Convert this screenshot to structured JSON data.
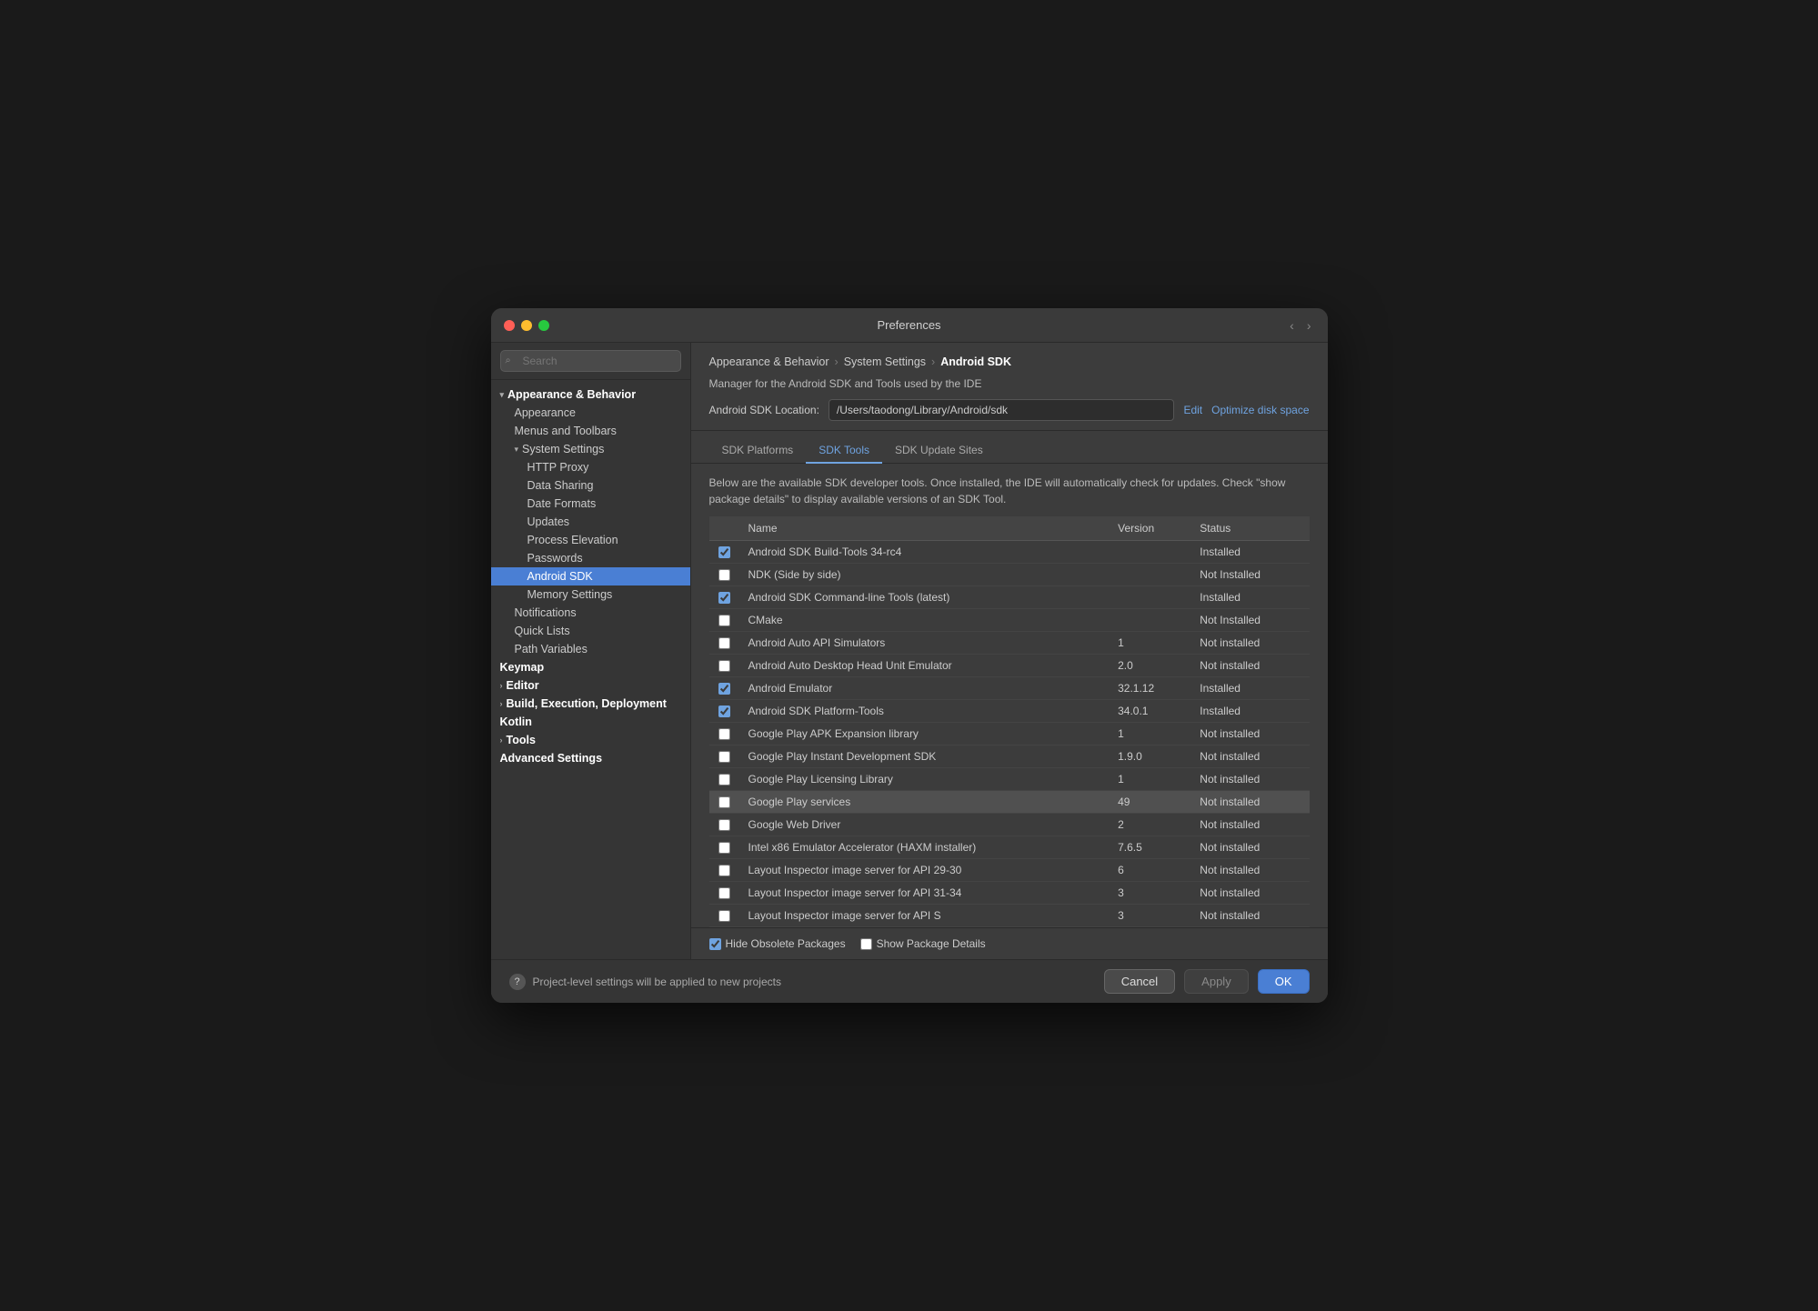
{
  "window": {
    "title": "Preferences"
  },
  "breadcrumb": {
    "part1": "Appearance & Behavior",
    "part2": "System Settings",
    "part3": "Android SDK"
  },
  "sidebar": {
    "search_placeholder": "Search",
    "items": [
      {
        "id": "appearance-behavior",
        "label": "Appearance & Behavior",
        "level": "group",
        "expanded": true,
        "chevron": "▾"
      },
      {
        "id": "appearance",
        "label": "Appearance",
        "level": "sub"
      },
      {
        "id": "menus-toolbars",
        "label": "Menus and Toolbars",
        "level": "sub"
      },
      {
        "id": "system-settings",
        "label": "System Settings",
        "level": "sub",
        "expanded": true,
        "chevron": "▾"
      },
      {
        "id": "http-proxy",
        "label": "HTTP Proxy",
        "level": "subsub"
      },
      {
        "id": "data-sharing",
        "label": "Data Sharing",
        "level": "subsub"
      },
      {
        "id": "date-formats",
        "label": "Date Formats",
        "level": "subsub"
      },
      {
        "id": "updates",
        "label": "Updates",
        "level": "subsub"
      },
      {
        "id": "process-elevation",
        "label": "Process Elevation",
        "level": "subsub"
      },
      {
        "id": "passwords",
        "label": "Passwords",
        "level": "subsub"
      },
      {
        "id": "android-sdk",
        "label": "Android SDK",
        "level": "subsub",
        "active": true
      },
      {
        "id": "memory-settings",
        "label": "Memory Settings",
        "level": "subsub"
      },
      {
        "id": "notifications",
        "label": "Notifications",
        "level": "sub"
      },
      {
        "id": "quick-lists",
        "label": "Quick Lists",
        "level": "sub"
      },
      {
        "id": "path-variables",
        "label": "Path Variables",
        "level": "sub"
      },
      {
        "id": "keymap",
        "label": "Keymap",
        "level": "group"
      },
      {
        "id": "editor",
        "label": "Editor",
        "level": "group",
        "chevron": "›"
      },
      {
        "id": "build-execution",
        "label": "Build, Execution, Deployment",
        "level": "group",
        "chevron": "›"
      },
      {
        "id": "kotlin",
        "label": "Kotlin",
        "level": "group"
      },
      {
        "id": "tools",
        "label": "Tools",
        "level": "group",
        "chevron": "›"
      },
      {
        "id": "advanced-settings",
        "label": "Advanced Settings",
        "level": "group"
      }
    ]
  },
  "panel": {
    "description": "Manager for the Android SDK and Tools used by the IDE",
    "sdk_location_label": "Android SDK Location:",
    "sdk_location_value": "/Users/taodong/Library/Android/sdk",
    "edit_label": "Edit",
    "optimize_label": "Optimize disk space"
  },
  "tabs": [
    {
      "id": "sdk-platforms",
      "label": "SDK Platforms"
    },
    {
      "id": "sdk-tools",
      "label": "SDK Tools",
      "active": true
    },
    {
      "id": "sdk-update-sites",
      "label": "SDK Update Sites"
    }
  ],
  "table": {
    "description": "Below are the available SDK developer tools. Once installed, the IDE will automatically check for updates. Check \"show package details\" to display available versions of an SDK Tool.",
    "columns": [
      "",
      "Name",
      "Version",
      "Status"
    ],
    "rows": [
      {
        "checked": true,
        "name": "Android SDK Build-Tools 34-rc4",
        "version": "",
        "status": "Installed",
        "highlighted": false
      },
      {
        "checked": false,
        "name": "NDK (Side by side)",
        "version": "",
        "status": "Not Installed",
        "highlighted": false
      },
      {
        "checked": true,
        "name": "Android SDK Command-line Tools (latest)",
        "version": "",
        "status": "Installed",
        "highlighted": false
      },
      {
        "checked": false,
        "name": "CMake",
        "version": "",
        "status": "Not Installed",
        "highlighted": false
      },
      {
        "checked": false,
        "name": "Android Auto API Simulators",
        "version": "1",
        "status": "Not installed",
        "highlighted": false
      },
      {
        "checked": false,
        "name": "Android Auto Desktop Head Unit Emulator",
        "version": "2.0",
        "status": "Not installed",
        "highlighted": false
      },
      {
        "checked": true,
        "name": "Android Emulator",
        "version": "32.1.12",
        "status": "Installed",
        "highlighted": false
      },
      {
        "checked": true,
        "name": "Android SDK Platform-Tools",
        "version": "34.0.1",
        "status": "Installed",
        "highlighted": false
      },
      {
        "checked": false,
        "name": "Google Play APK Expansion library",
        "version": "1",
        "status": "Not installed",
        "highlighted": false
      },
      {
        "checked": false,
        "name": "Google Play Instant Development SDK",
        "version": "1.9.0",
        "status": "Not installed",
        "highlighted": false
      },
      {
        "checked": false,
        "name": "Google Play Licensing Library",
        "version": "1",
        "status": "Not installed",
        "highlighted": false
      },
      {
        "checked": false,
        "name": "Google Play services",
        "version": "49",
        "status": "Not installed",
        "highlighted": true
      },
      {
        "checked": false,
        "name": "Google Web Driver",
        "version": "2",
        "status": "Not installed",
        "highlighted": false
      },
      {
        "checked": false,
        "name": "Intel x86 Emulator Accelerator (HAXM installer)",
        "version": "7.6.5",
        "status": "Not installed",
        "highlighted": false
      },
      {
        "checked": false,
        "name": "Layout Inspector image server for API 29-30",
        "version": "6",
        "status": "Not installed",
        "highlighted": false
      },
      {
        "checked": false,
        "name": "Layout Inspector image server for API 31-34",
        "version": "3",
        "status": "Not installed",
        "highlighted": false
      },
      {
        "checked": false,
        "name": "Layout Inspector image server for API S",
        "version": "3",
        "status": "Not installed",
        "highlighted": false
      }
    ]
  },
  "footer": {
    "hide_obsolete_label": "Hide Obsolete Packages",
    "hide_obsolete_checked": true,
    "show_package_label": "Show Package Details",
    "show_package_checked": false
  },
  "bottom_bar": {
    "info_text": "Project-level settings will be applied to new projects",
    "cancel_label": "Cancel",
    "apply_label": "Apply",
    "ok_label": "OK"
  }
}
